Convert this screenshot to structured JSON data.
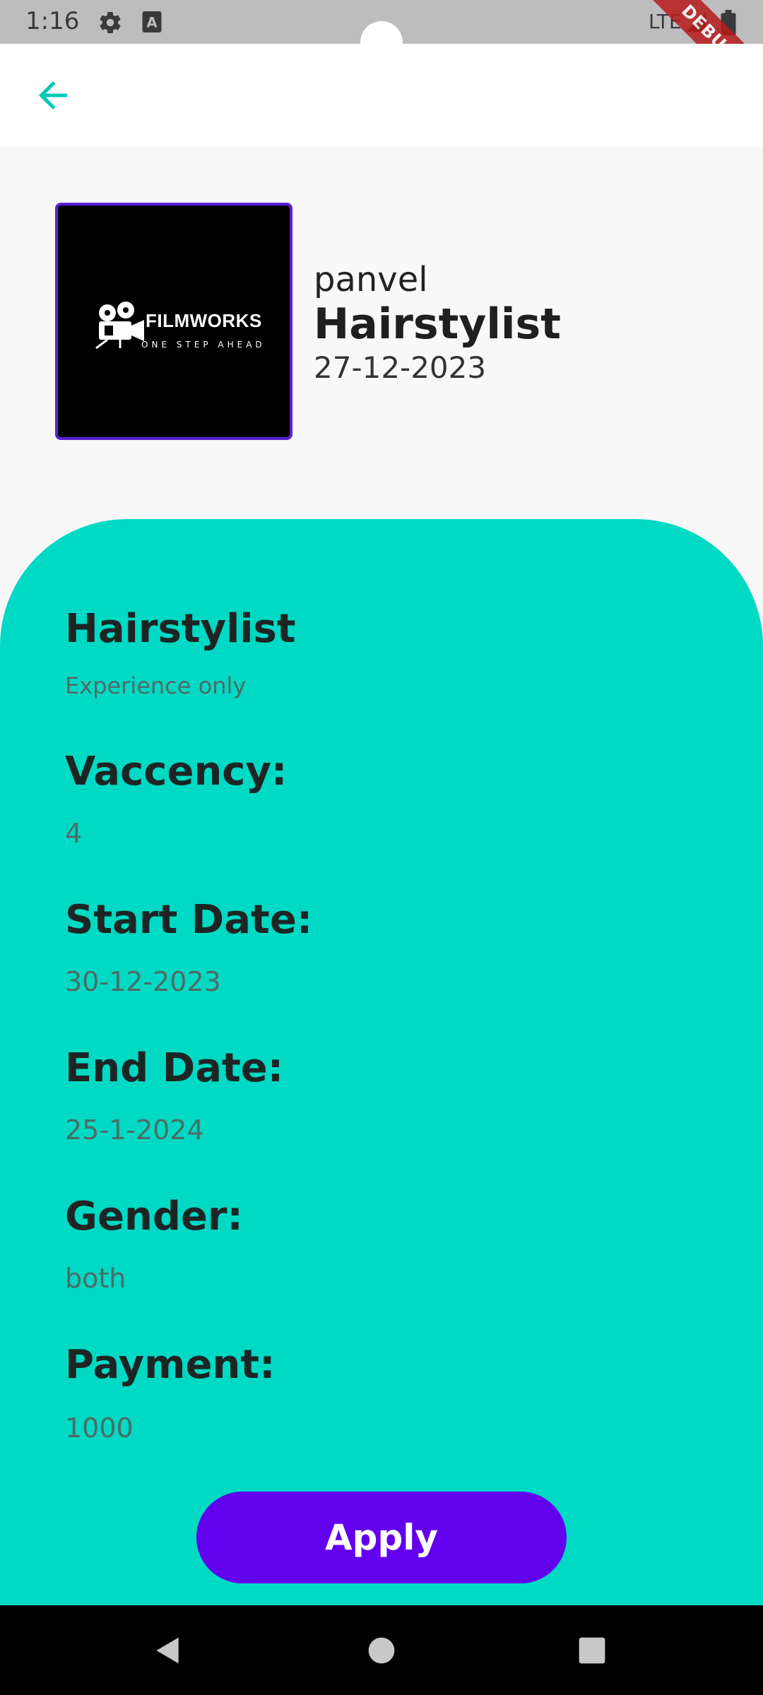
{
  "status_bar": {
    "time": "1:16",
    "network": "LTE",
    "icons": [
      "settings-icon",
      "keyboard-a-icon",
      "signal-icon",
      "battery-icon"
    ],
    "debug_banner": "DEBUG"
  },
  "app_bar": {
    "back_icon": "arrow-left-icon",
    "accent_color": "#00c9b7"
  },
  "header": {
    "logo": {
      "title": "FILMWORKS",
      "tagline": "ONE STEP AHEAD"
    },
    "location": "panvel",
    "title": "Hairstylist",
    "date": "27-12-2023"
  },
  "details": {
    "panel_color": "#00d9c4",
    "job_title": "Hairstylist",
    "job_note": "Experience only",
    "fields": [
      {
        "label": "Vaccency:",
        "value": "4"
      },
      {
        "label": "Start Date:",
        "value": "30-12-2023"
      },
      {
        "label": "End Date:",
        "value": "25-1-2024"
      },
      {
        "label": "Gender:",
        "value": "both"
      },
      {
        "label": "Payment:",
        "value": "1000"
      }
    ]
  },
  "actions": {
    "apply_label": "Apply",
    "apply_color": "#6200ee"
  },
  "nav_bar": {
    "icons": [
      "back-triangle-icon",
      "home-circle-icon",
      "recents-square-icon"
    ]
  }
}
